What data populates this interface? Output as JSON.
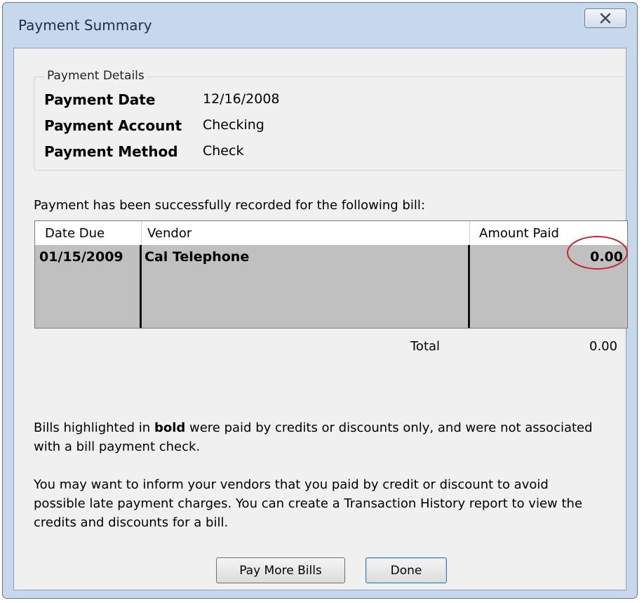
{
  "window": {
    "title": "Payment Summary",
    "close_icon": "close-x-icon"
  },
  "payment_details": {
    "legend": "Payment Details",
    "rows": [
      {
        "label": "Payment Date",
        "value": "12/16/2008"
      },
      {
        "label": "Payment Account",
        "value": "Checking"
      },
      {
        "label": "Payment Method",
        "value": "Check"
      }
    ]
  },
  "message_recorded": "Payment has been successfully recorded for the following bill:",
  "table": {
    "columns": [
      "Date Due",
      "Vendor",
      "Amount Paid"
    ],
    "rows": [
      {
        "date_due": "01/15/2009",
        "vendor": "Cal Telephone",
        "amount_paid": "0.00"
      }
    ],
    "total_label": "Total",
    "total_value": "0.00"
  },
  "note_bold": {
    "prefix": "Bills highlighted in ",
    "bold": "bold",
    "suffix": " were paid by credits or discounts only, and were not associated",
    "line2": "with a bill payment check."
  },
  "note_inform": {
    "line1": "You may want to inform your vendors that you paid by credit or discount to avoid",
    "line2": "possible late payment charges. You can create a Transaction History report to view the",
    "line3": "credits and discounts for a bill."
  },
  "buttons": {
    "pay_more": "Pay More Bills",
    "done": "Done"
  },
  "colors": {
    "highlight_circle": "#c1272d",
    "row_background": "#c0c0c0",
    "window_frame": "#c7d8ec"
  }
}
